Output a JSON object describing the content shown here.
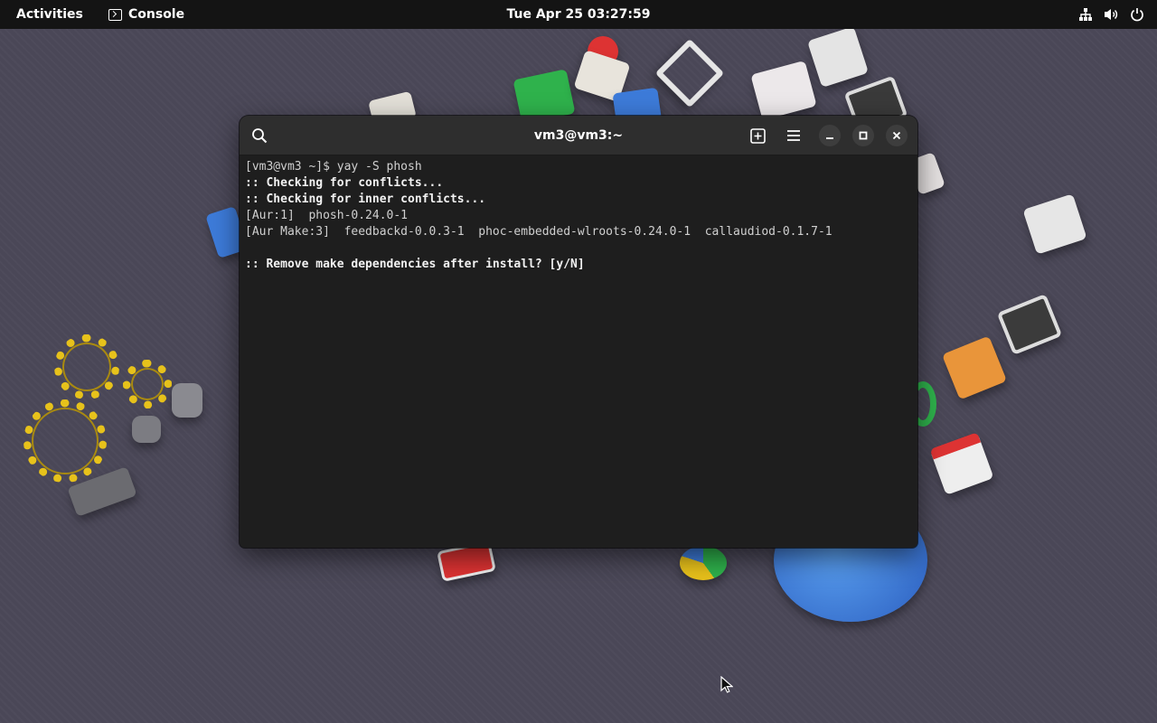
{
  "topbar": {
    "activities_label": "Activities",
    "app_name": "Console",
    "app_icon": "terminal-icon",
    "clock": "Tue Apr 25  03:27:59",
    "tray_icons": [
      "network-icon",
      "volume-icon",
      "power-icon"
    ]
  },
  "window": {
    "title": "vm3@vm3:~",
    "header_icons": [
      "search-icon",
      "new-tab-icon",
      "menu-icon",
      "minimize-icon",
      "maximize-icon",
      "close-icon"
    ],
    "terminal_lines": [
      {
        "text": "[vm3@vm3 ~]$ yay -S phosh",
        "bold": false
      },
      {
        "text": ":: Checking for conflicts...",
        "bold": true
      },
      {
        "text": ":: Checking for inner conflicts...",
        "bold": true
      },
      {
        "text": "[Aur:1]  phosh-0.24.0-1",
        "bold": false
      },
      {
        "text": "[Aur Make:3]  feedbackd-0.0.3-1  phoc-embedded-wlroots-0.24.0-1  callaudiod-0.1.7-1",
        "bold": false
      },
      {
        "text": "",
        "bold": false
      },
      {
        "text": ":: Remove make dependencies after install? [y/N]",
        "bold": true
      }
    ]
  },
  "colors": {
    "topbar_bg": "#141414",
    "window_bg": "#1e1e1e",
    "headerbar_bg": "#2e2e2e",
    "terminal_text": "#d0d0d0",
    "desktop_bg": "#4a4757"
  }
}
